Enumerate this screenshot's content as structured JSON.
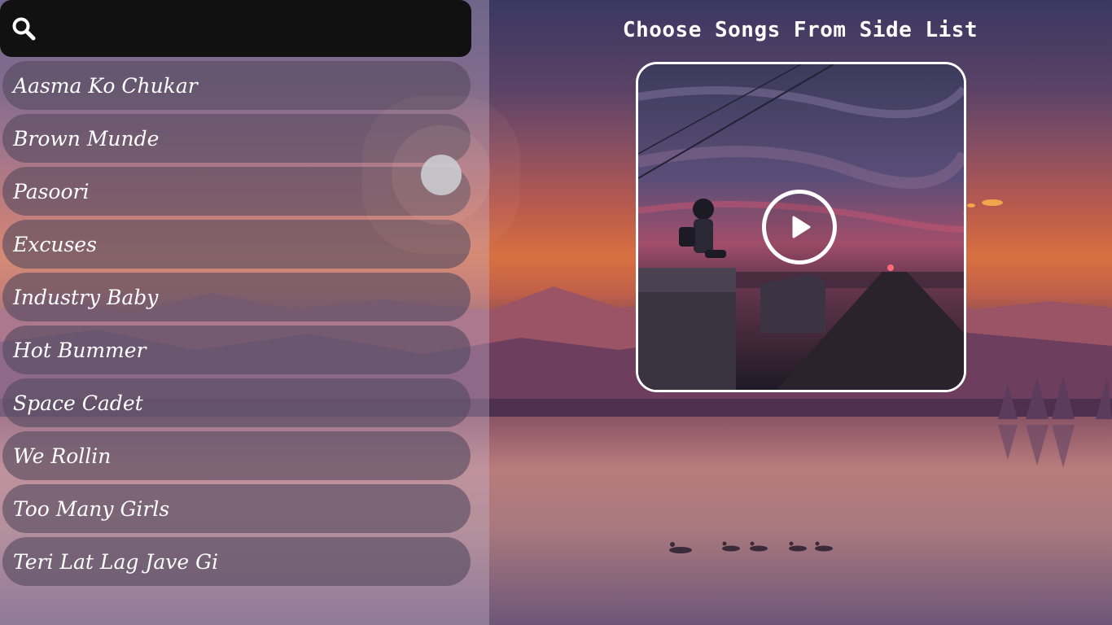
{
  "search": {
    "placeholder": "",
    "value": "",
    "icon": "search-icon"
  },
  "songs": [
    {
      "label": "Aasma Ko Chukar"
    },
    {
      "label": "Brown Munde"
    },
    {
      "label": "Pasoori"
    },
    {
      "label": "Excuses"
    },
    {
      "label": "Industry Baby"
    },
    {
      "label": "Hot Bummer"
    },
    {
      "label": "Space Cadet"
    },
    {
      "label": "We Rollin"
    },
    {
      "label": "Too Many Girls"
    },
    {
      "label": "Teri Lat Lag Jave Gi"
    }
  ],
  "main": {
    "title": "Choose Songs From Side List",
    "play_icon": "play-icon"
  },
  "colors": {
    "search_bar": "#111111",
    "text": "#ffffff",
    "accent_sunset": "#d87040"
  }
}
